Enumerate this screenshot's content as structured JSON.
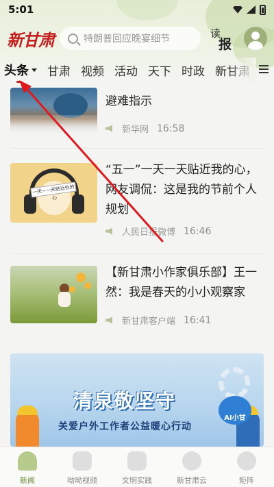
{
  "status_bar": {
    "time": "5:01"
  },
  "header": {
    "logo": "新甘肃",
    "search_placeholder": "特朗普回应晚宴细节",
    "read_paper_small": "读",
    "read_paper_big": "报"
  },
  "tabs": [
    {
      "label": "头条",
      "active": true
    },
    {
      "label": "甘肃"
    },
    {
      "label": "视频"
    },
    {
      "label": "活动"
    },
    {
      "label": "天下"
    },
    {
      "label": "时政"
    },
    {
      "label": "新甘肃"
    }
  ],
  "articles": [
    {
      "title": "避难指示",
      "source": "新华网",
      "time": "16:58"
    },
    {
      "title": "“五一”一天一天贴近我的心，网友调侃：这是我的节前个人规划",
      "source": "人民日报微博",
      "time": "16:46",
      "thumb_ribbon": "一天~一天贴近你的心"
    },
    {
      "title": "【新甘肃小作家俱乐部】王一然：我是春天的小小观察家",
      "source": "新甘肃客户端",
      "time": "16:41"
    }
  ],
  "banner": {
    "title": "清泉敬坚守",
    "subtitle": "关爱户外工作者公益暖心行动",
    "badge": "AI小甘"
  },
  "bottom_nav": [
    {
      "label": "新闻",
      "icon": "news-icon",
      "active": true
    },
    {
      "label": "呦呦视频",
      "icon": "video-icon"
    },
    {
      "label": "文明实践",
      "icon": "civilization-icon"
    },
    {
      "label": "新甘肃云",
      "icon": "cloud-icon"
    },
    {
      "label": "矩阵",
      "icon": "matrix-icon"
    }
  ],
  "colors": {
    "brand_red": "#c41e1e",
    "annotation_arrow": "#e0191f",
    "nav_active": "#6e8c3c"
  }
}
